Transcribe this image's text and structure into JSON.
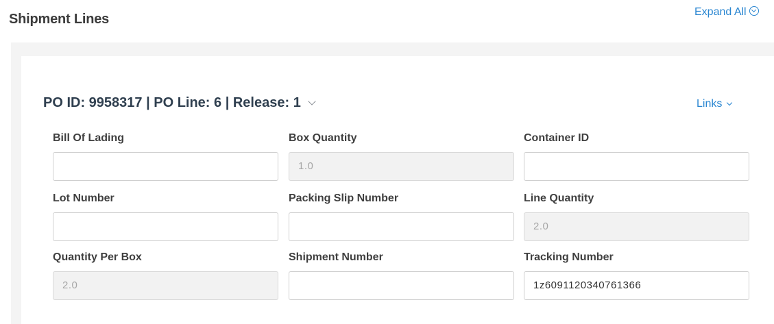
{
  "header": {
    "title": "Shipment Lines",
    "expand_all_label": "Expand All"
  },
  "line": {
    "title": "PO ID: 9958317 | PO Line: 6 | Release: 1",
    "links_label": "Links",
    "fields": {
      "bill_of_lading": {
        "label": "Bill Of Lading",
        "value": ""
      },
      "box_quantity": {
        "label": "Box Quantity",
        "value": "1.0"
      },
      "container_id": {
        "label": "Container ID",
        "value": ""
      },
      "lot_number": {
        "label": "Lot Number",
        "value": ""
      },
      "packing_slip_number": {
        "label": "Packing Slip Number",
        "value": ""
      },
      "line_quantity": {
        "label": "Line Quantity",
        "value": "2.0"
      },
      "quantity_per_box": {
        "label": "Quantity Per Box",
        "value": "2.0"
      },
      "shipment_number": {
        "label": "Shipment Number",
        "value": ""
      },
      "tracking_number": {
        "label": "Tracking Number",
        "value": "1z6091120340761366"
      }
    }
  },
  "colors": {
    "link": "#2a86d1",
    "card_title": "#2f3f4f",
    "disabled_bg": "#f2f2f2"
  },
  "icons": {
    "expand_all": "circle-chevron-down-icon",
    "title_toggle": "chevron-down-icon",
    "links_toggle": "chevron-down-icon"
  }
}
